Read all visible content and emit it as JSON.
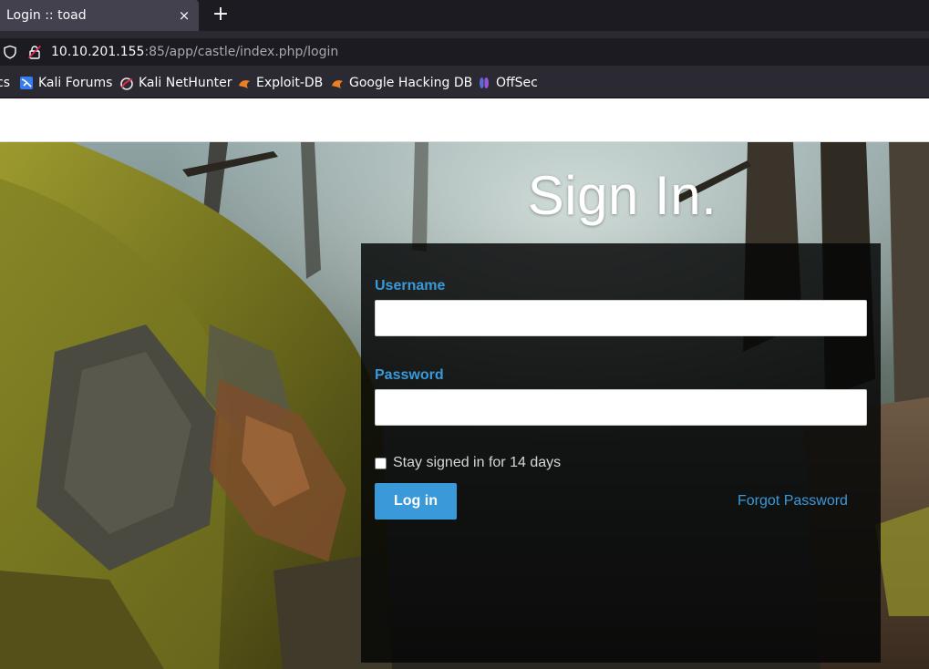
{
  "browser": {
    "tab": {
      "title": "Login :: toad",
      "close_glyph": "×"
    },
    "new_tab_glyph": "+",
    "url": {
      "host": "10.10.201.155",
      "path": ":85/app/castle/index.php/login"
    },
    "bookmarks": [
      {
        "label": "cs",
        "icon": "none"
      },
      {
        "label": "Kali Forums",
        "icon": "kali-forums-icon"
      },
      {
        "label": "Kali NetHunter",
        "icon": "kali-nethunter-icon"
      },
      {
        "label": "Exploit-DB",
        "icon": "exploit-db-icon"
      },
      {
        "label": "Google Hacking DB",
        "icon": "ghdb-icon"
      },
      {
        "label": "OffSec",
        "icon": "offsec-icon"
      }
    ]
  },
  "login": {
    "title": "Sign In.",
    "username_label": "Username",
    "username_value": "",
    "password_label": "Password",
    "password_value": "",
    "remember_label": "Stay signed in for 14 days",
    "remember_checked": false,
    "login_button": "Log in",
    "forgot_link": "Forgot Password"
  },
  "colors": {
    "accent": "#3a99d8",
    "panel": "#050606",
    "chrome_dark": "#1c1b22",
    "chrome_tab": "#42414d"
  }
}
